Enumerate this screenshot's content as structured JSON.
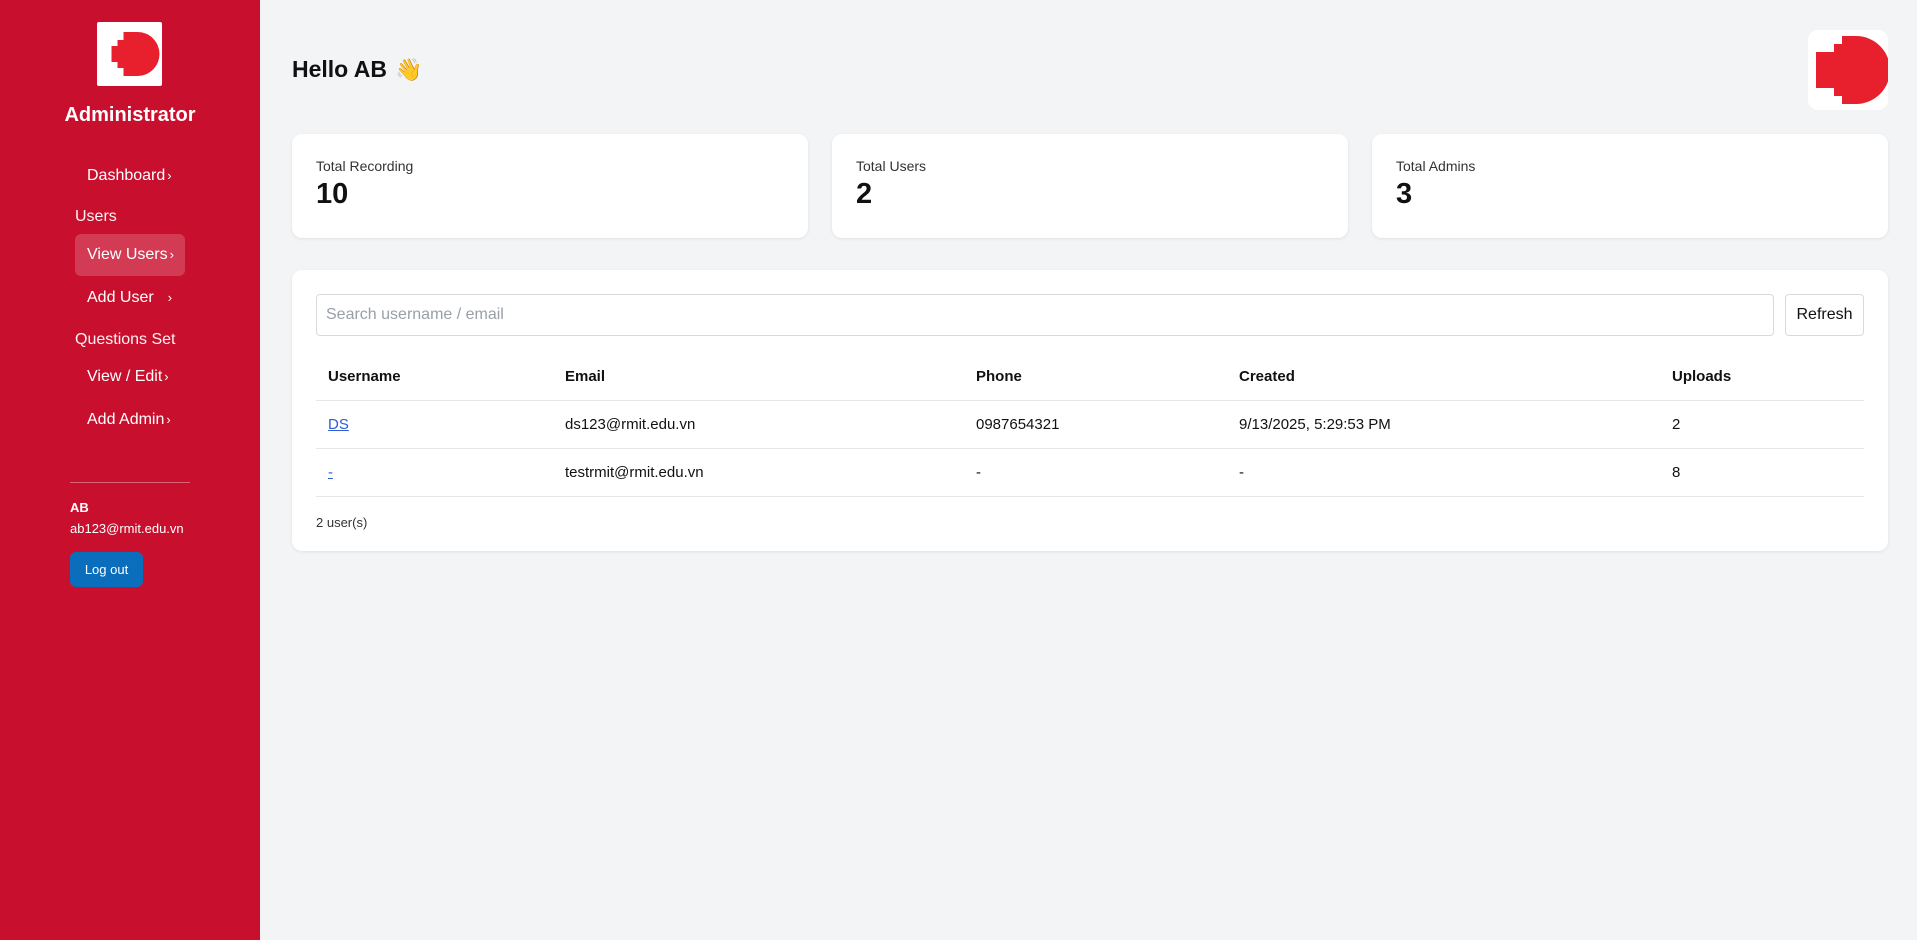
{
  "sidebar": {
    "brand": "Administrator",
    "items": [
      {
        "label": "Dashboard",
        "chevron": "›"
      },
      {
        "label": "View Users",
        "chevron": "›"
      },
      {
        "label": "Add User",
        "chevron": "›"
      },
      {
        "label": "View / Edit",
        "chevron": "›"
      },
      {
        "label": "Add Admin",
        "chevron": "›"
      }
    ],
    "sections": {
      "users": "Users",
      "questions": "Questions Set"
    },
    "user": {
      "name": "AB",
      "email": "ab123@rmit.edu.vn"
    },
    "logout_label": "Log out",
    "bg_color": "#c8102e"
  },
  "header": {
    "greeting": "Hello AB",
    "emoji": "👋"
  },
  "stats": [
    {
      "label": "Total Recording",
      "value": "10"
    },
    {
      "label": "Total Users",
      "value": "2"
    },
    {
      "label": "Total Admins",
      "value": "3"
    }
  ],
  "users_panel": {
    "search_placeholder": "Search username / email",
    "search_value": "",
    "refresh_label": "Refresh",
    "columns": [
      "Username",
      "Email",
      "Phone",
      "Created",
      "Uploads"
    ],
    "rows": [
      [
        "DS",
        "ds123@rmit.edu.vn",
        "0987654321",
        "9/13/2025, 5:29:53 PM",
        "2"
      ],
      [
        "-",
        "testrmit@rmit.edu.vn",
        "-",
        "-",
        "8"
      ]
    ],
    "count_text": "2 user(s)"
  },
  "colors": {
    "accent": "#c8102e",
    "button_blue": "#0a6ebd",
    "logo_red": "#e8202e"
  }
}
